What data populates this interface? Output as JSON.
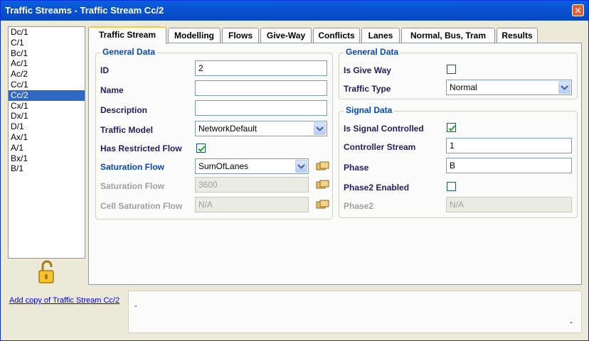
{
  "window": {
    "title": "Traffic Streams - Traffic Stream Cc/2"
  },
  "stream_list": [
    "Dc/1",
    "C/1",
    "Bc/1",
    "Ac/1",
    "Ac/2",
    "Cc/1",
    "Cc/2",
    "Cx/1",
    "Dx/1",
    "D/1",
    "Ax/1",
    "A/1",
    "Bx/1",
    "B/1"
  ],
  "selected_stream": "Cc/2",
  "tabs": [
    "Traffic Stream",
    "Modelling",
    "Flows",
    "Give-Way",
    "Conflicts",
    "Lanes",
    "Normal, Bus, Tram",
    "Results"
  ],
  "general_data_left": {
    "title": "General Data",
    "id_label": "ID",
    "id_value": "2",
    "name_label": "Name",
    "name_value": "",
    "description_label": "Description",
    "description_value": "",
    "traffic_model_label": "Traffic Model",
    "traffic_model_value": "NetworkDefault",
    "has_restricted_flow_label": "Has Restricted Flow",
    "has_restricted_flow": true,
    "saturation_flow_label": "Saturation Flow",
    "saturation_flow_value": "SumOfLanes",
    "saturation_flow_disabled_label": "Saturation Flow",
    "saturation_flow_disabled_value": "3600",
    "cell_saturation_flow_label": "Cell Saturation Flow",
    "cell_saturation_flow_value": "N/A"
  },
  "general_data_right": {
    "title": "General Data",
    "is_give_way_label": "Is Give Way",
    "is_give_way": false,
    "traffic_type_label": "Traffic Type",
    "traffic_type_value": "Normal"
  },
  "signal_data": {
    "title": "Signal Data",
    "is_signal_controlled_label": "Is Signal Controlled",
    "is_signal_controlled": true,
    "controller_stream_label": "Controller Stream",
    "controller_stream_value": "1",
    "phase_label": "Phase",
    "phase_value": "B",
    "phase2_enabled_label": "Phase2 Enabled",
    "phase2_enabled": false,
    "phase2_label": "Phase2",
    "phase2_value": "N/A"
  },
  "footer": {
    "add_copy_link": "Add copy of Traffic Stream Cc/2",
    "status_top": "-",
    "status_bottom": "-"
  },
  "colors": {
    "title_bar": "#0853d0",
    "group_title": "#0046d5",
    "label": "#1e1e64",
    "selection": "#316ac5",
    "tab_highlight": "#ffc83c"
  }
}
